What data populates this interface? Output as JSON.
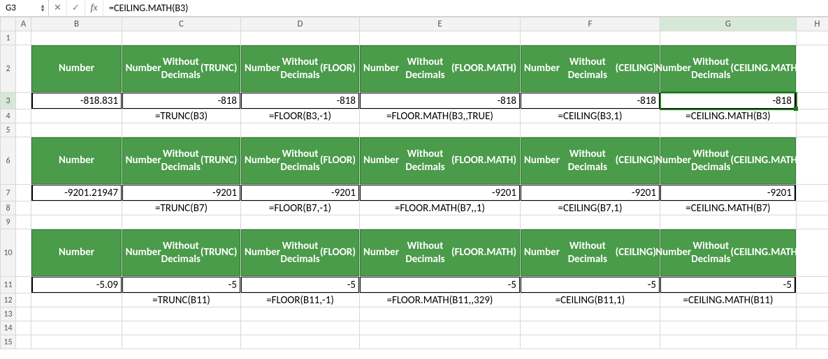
{
  "nameBox": "G3",
  "formula": "=CEILING.MATH(B3)",
  "columns": [
    "A",
    "B",
    "C",
    "D",
    "E",
    "F",
    "G",
    "H"
  ],
  "selectedCol": "G",
  "selectedRow": 3,
  "rowCount": 15,
  "headers": {
    "B": "Number",
    "C": "Number\nWithout Decimals\n(TRUNC)",
    "D": "Number\nWithout Decimals\n(FLOOR)",
    "E": "Number\nWithout Decimals\n(FLOOR.MATH)",
    "F": "Number\nWithout Decimals\n(CEILING)",
    "G": "Number\nWithout Decimals\n(CEILING.MATH)"
  },
  "blocks": [
    {
      "headerRow": 2,
      "valueRow": 3,
      "formulaRow": 4,
      "values": {
        "B": "-818.831",
        "C": "-818",
        "D": "-818",
        "E": "-818",
        "F": "-818",
        "G": "-818"
      },
      "formulas": {
        "C": "=TRUNC(B3)",
        "D": "=FLOOR(B3,-1)",
        "E": "=FLOOR.MATH(B3,,TRUE)",
        "F": "=CEILING(B3,1)",
        "G": "=CEILING.MATH(B3)"
      }
    },
    {
      "headerRow": 6,
      "valueRow": 7,
      "formulaRow": 8,
      "values": {
        "B": "-9201.21947",
        "C": "-9201",
        "D": "-9201",
        "E": "-9201",
        "F": "-9201",
        "G": "-9201"
      },
      "formulas": {
        "C": "=TRUNC(B7)",
        "D": "=FLOOR(B7,-1)",
        "E": "=FLOOR.MATH(B7,,1)",
        "F": "=CEILING(B7,1)",
        "G": "=CEILING.MATH(B7)"
      }
    },
    {
      "headerRow": 10,
      "valueRow": 11,
      "formulaRow": 12,
      "values": {
        "B": "-5.09",
        "C": "-5",
        "D": "-5",
        "E": "-5",
        "F": "-5",
        "G": "-5"
      },
      "formulas": {
        "C": "=TRUNC(B11)",
        "D": "=FLOOR(B11,-1)",
        "E": "=FLOOR.MATH(B11,,329)",
        "F": "=CEILING(B11,1)",
        "G": "=CEILING.MATH(B11)"
      }
    }
  ]
}
